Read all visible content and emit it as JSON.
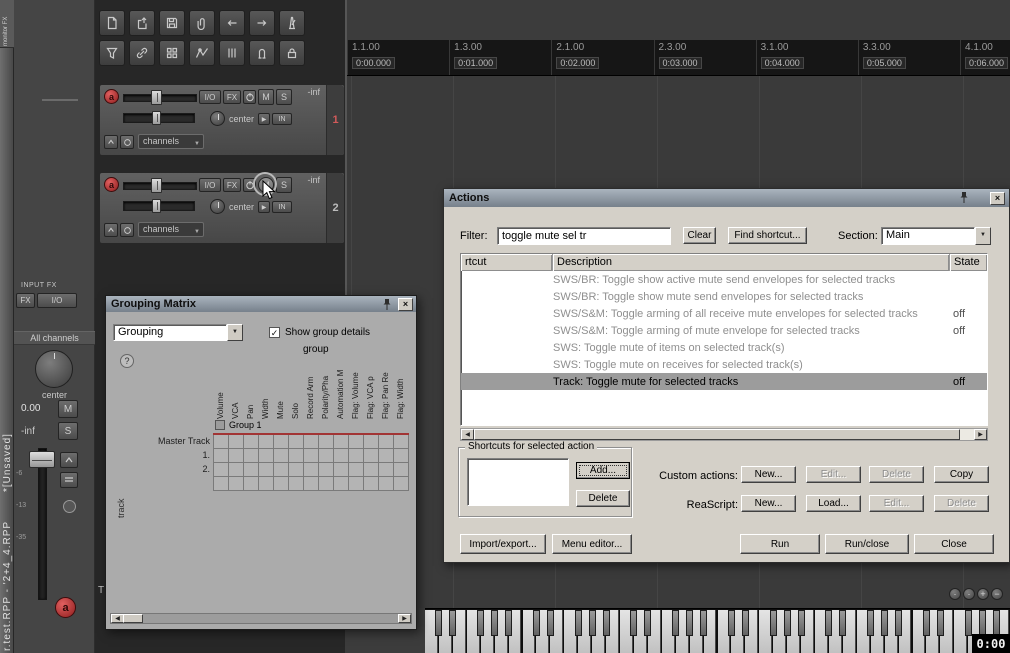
{
  "left_bar": {
    "monitor_fx": "monitor FX",
    "unsaved": "*[Unsaved]",
    "title": "r.test.RPP - '2+4_4.RPP"
  },
  "toolbar": {
    "icons": [
      "new-document",
      "open-document",
      "save",
      "paperclip",
      "undo-arrow",
      "redo-arrow",
      "metronome",
      "filter-funnel",
      "chain-link",
      "grid-squares",
      "envelope-wave",
      "snap-lines",
      "magnet",
      "padlock"
    ]
  },
  "timeline": {
    "markers": [
      {
        "bar": "1.1.00",
        "time": "0:00.000"
      },
      {
        "bar": "1.3.00",
        "time": "0:01.000"
      },
      {
        "bar": "2.1.00",
        "time": "0:02.000"
      },
      {
        "bar": "2.3.00",
        "time": "0:03.000"
      },
      {
        "bar": "3.1.00",
        "time": "0:04.000"
      },
      {
        "bar": "3.3.00",
        "time": "0:05.000"
      },
      {
        "bar": "4.1.00",
        "time": "0:06.000"
      }
    ]
  },
  "master": {
    "input_fx_label": "INPUT FX",
    "fx_button": "FX",
    "io_button": "I/O",
    "all_channels": "All channels",
    "pan_label": "center",
    "volume_value": "0.00",
    "meter_value": "-inf",
    "mute": "M",
    "solo": "S",
    "rec_arm": "a",
    "fader_scale": [
      "-6",
      "-13",
      "-35"
    ]
  },
  "tracks": [
    {
      "number": "1",
      "volume": "-inf",
      "pan": "center",
      "rec_arm": "a",
      "io_button": "I/O",
      "fx_button": "FX",
      "mute": "M",
      "solo": "S",
      "monitor": "IN",
      "channels": "channels"
    },
    {
      "number": "2",
      "volume": "-inf",
      "pan": "center",
      "rec_arm": "a",
      "io_button": "I/O",
      "fx_button": "FX",
      "mute": "M",
      "solo": "S",
      "monitor": "IN",
      "channels": "channels"
    }
  ],
  "grouping": {
    "title": "Grouping Matrix",
    "mode_dropdown": "Grouping",
    "show_details_label": "Show group details",
    "show_details_checked": true,
    "help": "?",
    "group_header": "group",
    "group_name": "Group 1",
    "columns": [
      "Volume",
      "VCA",
      "Pan",
      "Width",
      "Mute",
      "Solo",
      "Record Arm",
      "Polarity/Pha",
      "Automation M",
      "Flag: Volume",
      "Flag: VCA p",
      "Flag: Pan Re",
      "Flag: Width"
    ],
    "row_labels": [
      "Master Track",
      "1.",
      "2.",
      ""
    ],
    "axis_label": "track"
  },
  "actions": {
    "title": "Actions",
    "filter_label": "Filter:",
    "filter_value": "toggle mute sel tr",
    "clear_button": "Clear",
    "find_shortcut_button": "Find shortcut...",
    "section_label": "Section:",
    "section_value": "Main",
    "list_headers": [
      "rtcut",
      "Description",
      "State"
    ],
    "rows": [
      {
        "description": "SWS/BR: Toggle show active mute send envelopes for selected tracks",
        "state": ""
      },
      {
        "description": "SWS/BR: Toggle show mute send envelopes for selected tracks",
        "state": ""
      },
      {
        "description": "SWS/S&M: Toggle arming of all receive mute envelopes for selected tracks",
        "state": "off"
      },
      {
        "description": "SWS/S&M: Toggle arming of mute envelope for selected tracks",
        "state": "off"
      },
      {
        "description": "SWS: Toggle mute of items on selected track(s)",
        "state": ""
      },
      {
        "description": "SWS: Toggle mute on receives for selected track(s)",
        "state": ""
      },
      {
        "description": "Track: Toggle mute for selected tracks",
        "state": "off",
        "selected": true
      }
    ],
    "shortcuts_group_label": "Shortcuts for selected action",
    "add_button": "Add...",
    "delete_button": "Delete",
    "custom_actions_label": "Custom actions:",
    "custom_buttons": [
      {
        "label": "New...",
        "enabled": true
      },
      {
        "label": "Edit...",
        "enabled": false
      },
      {
        "label": "Delete",
        "enabled": false
      },
      {
        "label": "Copy",
        "enabled": true
      }
    ],
    "reascript_label": "ReaScript:",
    "reascript_buttons": [
      {
        "label": "New...",
        "enabled": true
      },
      {
        "label": "Load...",
        "enabled": true
      },
      {
        "label": "Edit...",
        "enabled": false
      },
      {
        "label": "Delete",
        "enabled": false
      }
    ],
    "import_export_button": "Import/export...",
    "menu_editor_button": "Menu editor...",
    "run_button": "Run",
    "run_close_button": "Run/close",
    "close_button": "Close"
  },
  "bottom": {
    "docker_tab": "T",
    "clock": "0:00"
  }
}
